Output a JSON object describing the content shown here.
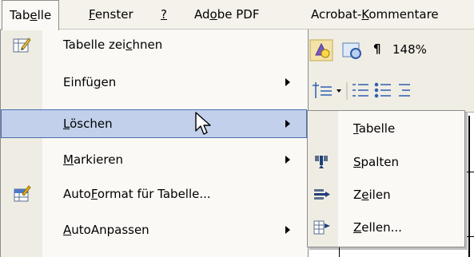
{
  "menubar": {
    "items": [
      {
        "pre": "Tab",
        "key": "e",
        "post": "lle"
      },
      {
        "pre": "",
        "key": "F",
        "post": "enster"
      },
      {
        "pre": "",
        "key": "?",
        "post": ""
      },
      {
        "pre": "Ad",
        "key": "o",
        "post": "be PDF"
      },
      {
        "pre": "Acrobat-",
        "key": "K",
        "post": "ommentare"
      }
    ]
  },
  "toolbar": {
    "zoom": "148%",
    "pilcrow": "¶"
  },
  "menu": {
    "items": [
      {
        "pre": "Tabelle zei",
        "key": "c",
        "post": "hnen",
        "icon": "draw-table-icon"
      },
      {
        "pre": "Einfü",
        "key": "g",
        "post": "en",
        "submenu": true
      },
      {
        "pre": "",
        "key": "L",
        "post": "öschen",
        "submenu": true,
        "highlighted": true
      },
      {
        "pre": "",
        "key": "M",
        "post": "arkieren",
        "submenu": true
      },
      {
        "pre": "Auto",
        "key": "F",
        "post": "ormat für Tabelle...",
        "icon": "autoformat-icon"
      },
      {
        "pre": "",
        "key": "A",
        "post": "utoAnpassen",
        "submenu": true
      }
    ]
  },
  "submenu": {
    "items": [
      {
        "pre": "",
        "key": "T",
        "post": "abelle"
      },
      {
        "pre": "",
        "key": "S",
        "post": "palten",
        "icon": "delete-columns-icon"
      },
      {
        "pre": "Z",
        "key": "e",
        "post": "ilen",
        "icon": "delete-rows-icon"
      },
      {
        "pre": "",
        "key": "Z",
        "post": "ellen...",
        "icon": "delete-cells-icon"
      }
    ]
  }
}
